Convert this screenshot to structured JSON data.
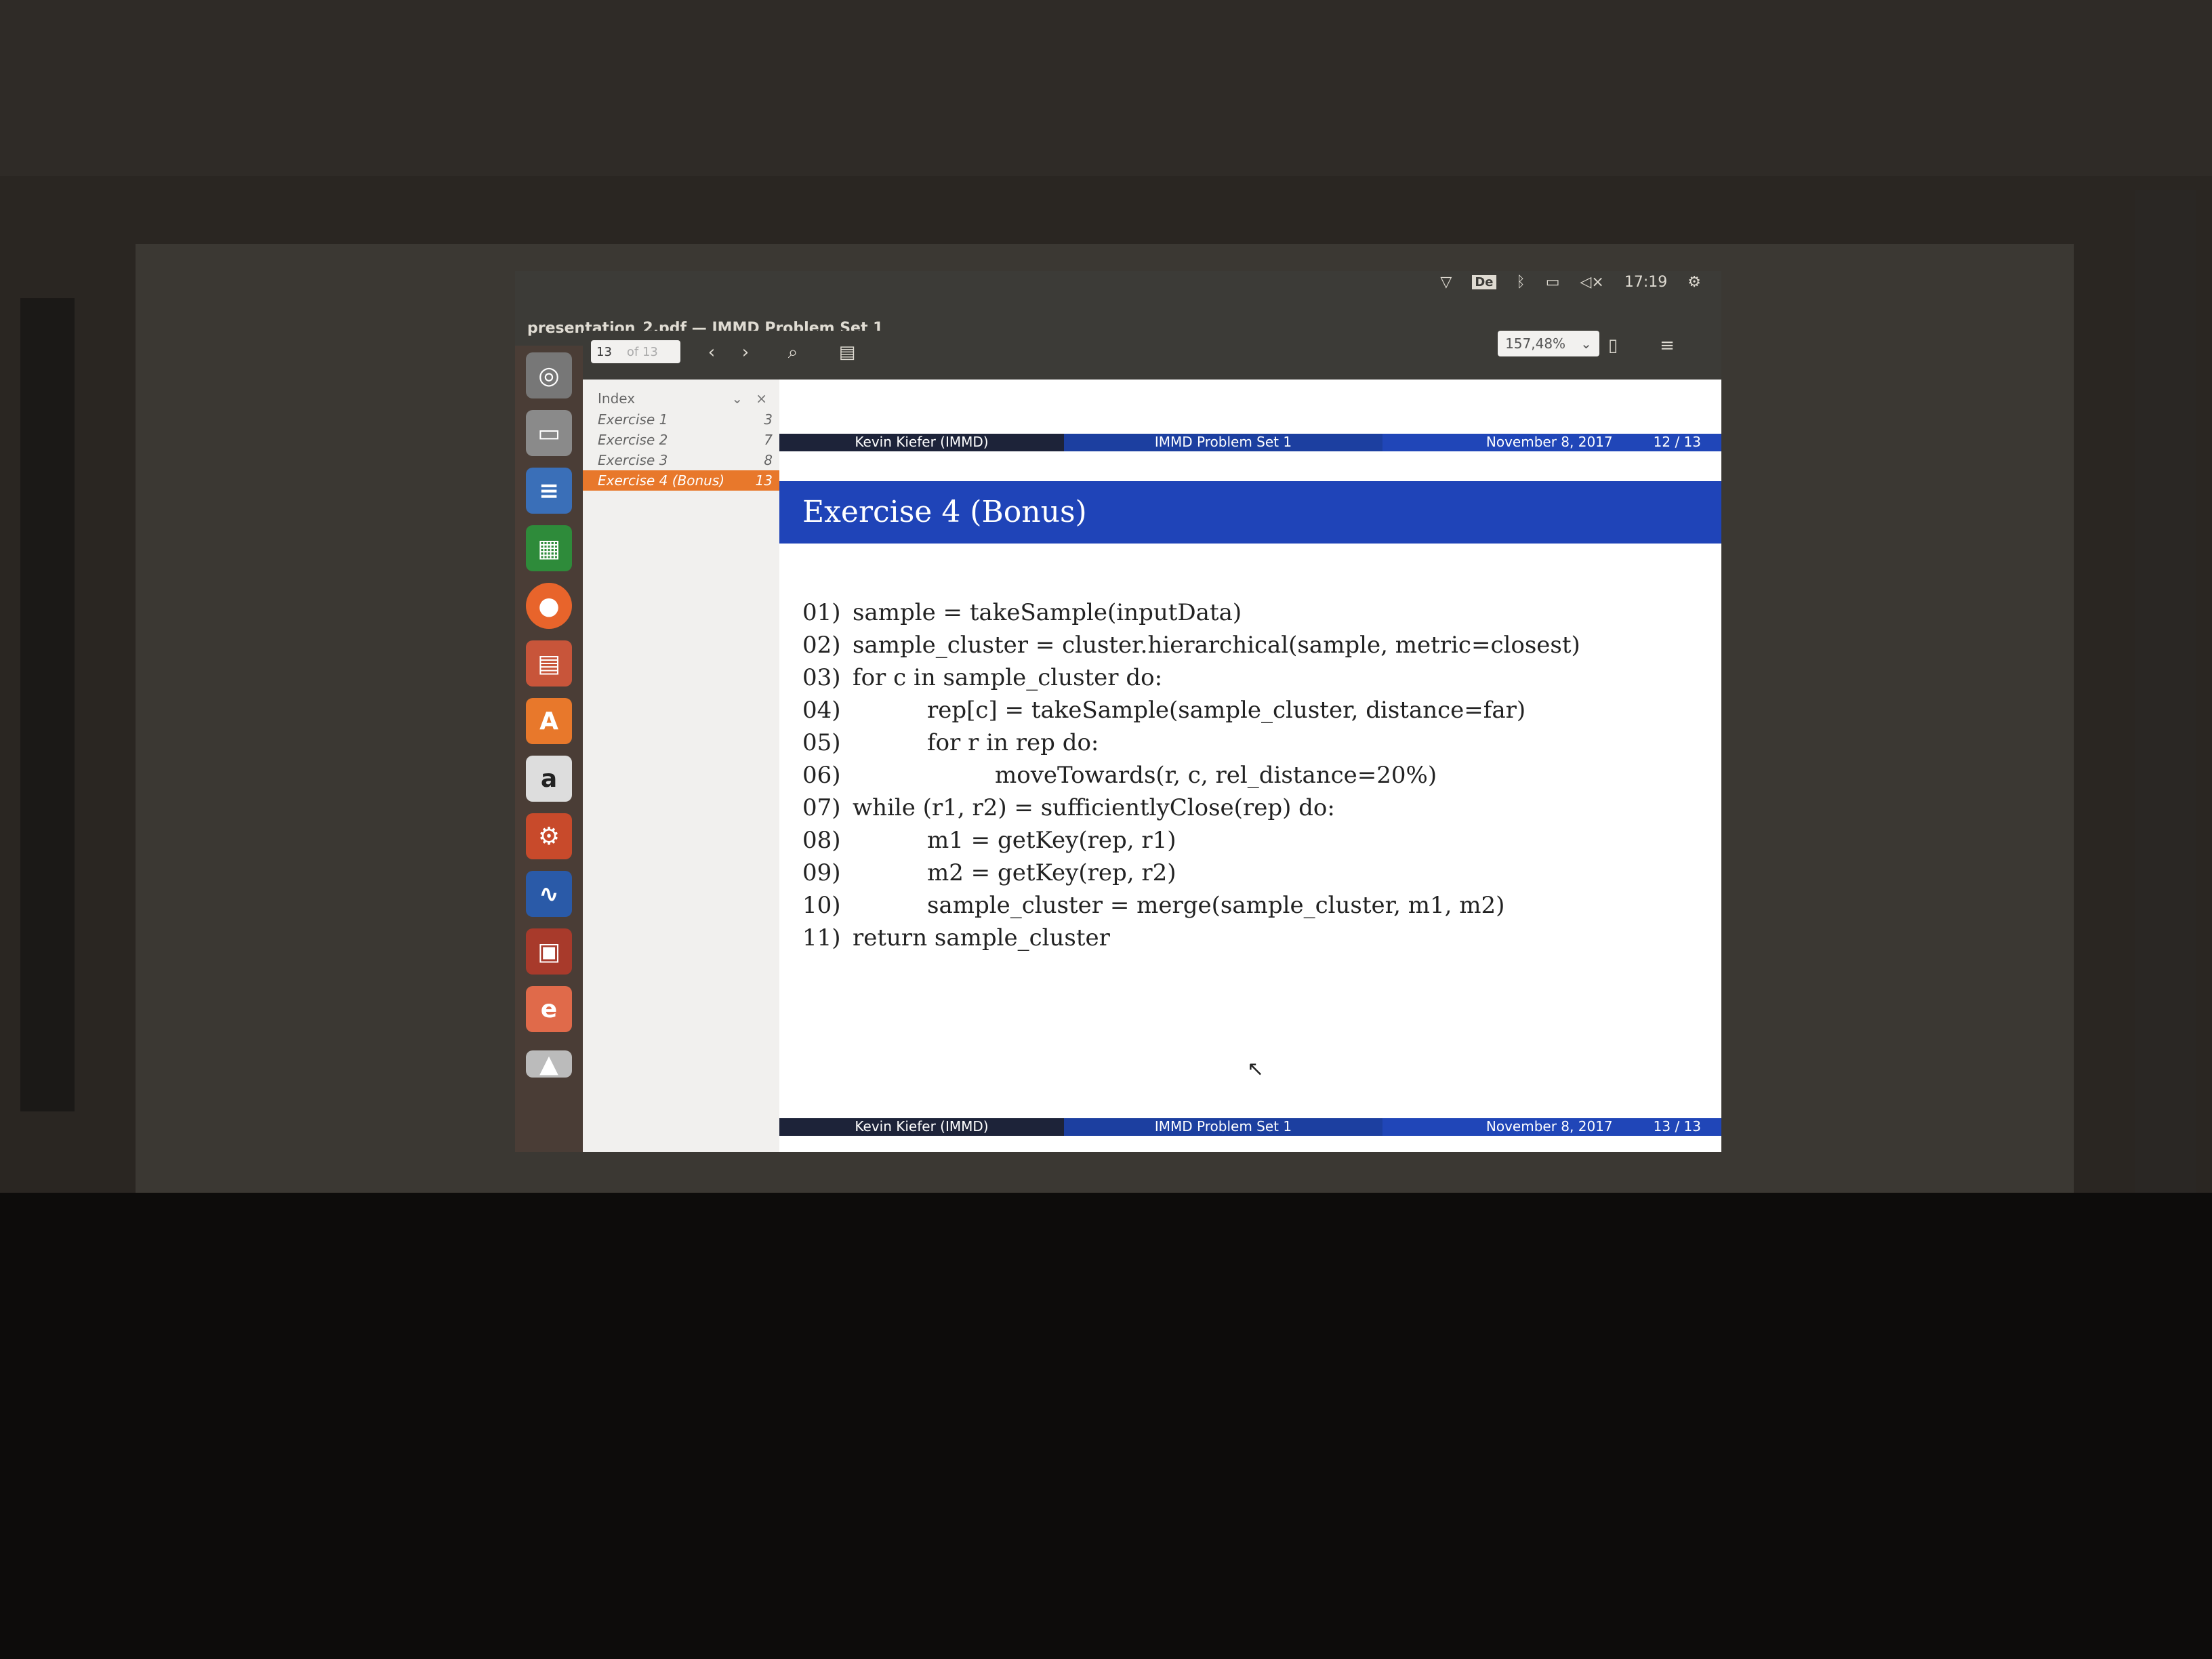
{
  "window": {
    "title": "presentation_2.pdf — IMMD Problem Set 1"
  },
  "tray": {
    "keyboard": "De",
    "time": "17:19"
  },
  "toolbar": {
    "page_current": "13",
    "page_of": "of 13",
    "zoom": "157,48%"
  },
  "sidebar": {
    "header": "Index",
    "close_symbol": "×",
    "items": [
      {
        "label": "Exercise 1",
        "page": "3"
      },
      {
        "label": "Exercise 2",
        "page": "7"
      },
      {
        "label": "Exercise 3",
        "page": "8"
      },
      {
        "label": "Exercise 4 (Bonus)",
        "page": "13"
      }
    ]
  },
  "slide": {
    "top_bar": {
      "author": "Kevin Kiefer (IMMD)",
      "title": "IMMD Problem Set 1",
      "date": "November 8, 2017",
      "page": "12 / 13"
    },
    "frame_title": "Exercise 4 (Bonus)",
    "code": [
      {
        "n": "01)",
        "text": "sample = takeSample(inputData)"
      },
      {
        "n": "02)",
        "text": "sample_cluster = cluster.hierarchical(sample, metric=closest)"
      },
      {
        "n": "03)",
        "text": "for c in sample_cluster do:"
      },
      {
        "n": "04)",
        "text": "rep[c] = takeSample(sample_cluster, distance=far)"
      },
      {
        "n": "05)",
        "text": "for r in rep do:"
      },
      {
        "n": "06)",
        "text": "moveTowards(r, c, rel_distance=20%)"
      },
      {
        "n": "07)",
        "text": "while (r1, r2) = sufficientlyClose(rep) do:"
      },
      {
        "n": "08)",
        "text": "m1 = getKey(rep, r1)"
      },
      {
        "n": "09)",
        "text": "m2 = getKey(rep, r2)"
      },
      {
        "n": "10)",
        "text": "sample_cluster = merge(sample_cluster, m1, m2)"
      },
      {
        "n": "11)",
        "text": "return sample_cluster"
      }
    ],
    "bottom_bar": {
      "author": "Kevin Kiefer (IMMD)",
      "title": "IMMD Problem Set 1",
      "date": "November 8, 2017",
      "page": "13 / 13"
    }
  },
  "launcher": {
    "icons": [
      "ubuntu-logo-icon",
      "files-icon",
      "writer-icon",
      "calc-icon",
      "firefox-icon",
      "impress-icon",
      "software-center-icon",
      "amazon-icon",
      "settings-icon",
      "system-monitor-icon",
      "screenshot-icon",
      "document-viewer-icon",
      "trash-icon"
    ]
  }
}
